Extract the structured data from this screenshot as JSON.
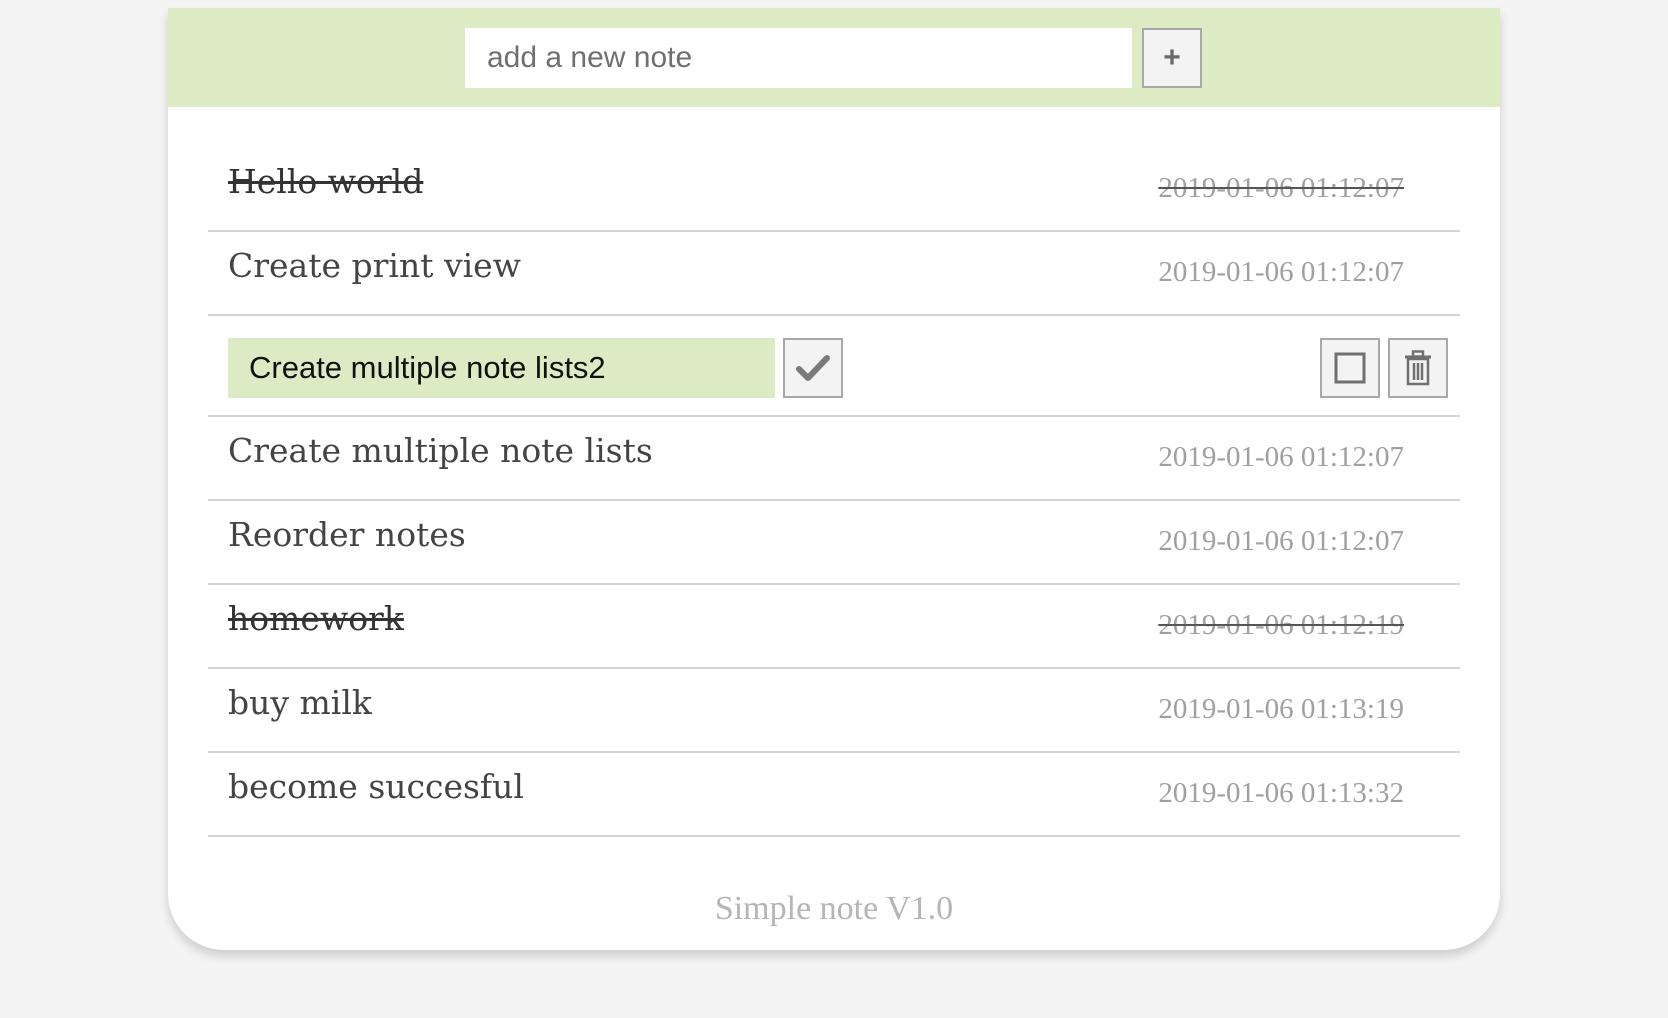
{
  "header": {
    "input_placeholder": "add a new note",
    "add_button_label": "+"
  },
  "notes": [
    {
      "text": "Hello world",
      "time": "2019-01-06 01:12:07",
      "done": true
    },
    {
      "text": "Create print view",
      "time": "2019-01-06 01:12:07",
      "done": false
    },
    {
      "text": "Create multiple note lists2",
      "editing": true
    },
    {
      "text": "Create multiple note lists",
      "time": "2019-01-06 01:12:07",
      "done": false
    },
    {
      "text": "Reorder notes",
      "time": "2019-01-06 01:12:07",
      "done": false
    },
    {
      "text": "homework",
      "time": "2019-01-06 01:12:19",
      "done": true
    },
    {
      "text": "buy milk",
      "time": "2019-01-06 01:13:19",
      "done": false
    },
    {
      "text": "become succesful",
      "time": "2019-01-06 01:13:32",
      "done": false
    }
  ],
  "edit_row_icons": {
    "confirm": "checkmark-icon",
    "toggle": "square-checkbox-icon",
    "delete": "trash-icon"
  },
  "footer": {
    "version_text": "Simple note V1.0"
  },
  "colors": {
    "header_bg": "#dcebc4",
    "edit_input_bg": "#dcebc4",
    "page_bg": "#f4f4f4",
    "timestamp": "#a0a0a0",
    "footer_text": "#b5b5b5"
  }
}
